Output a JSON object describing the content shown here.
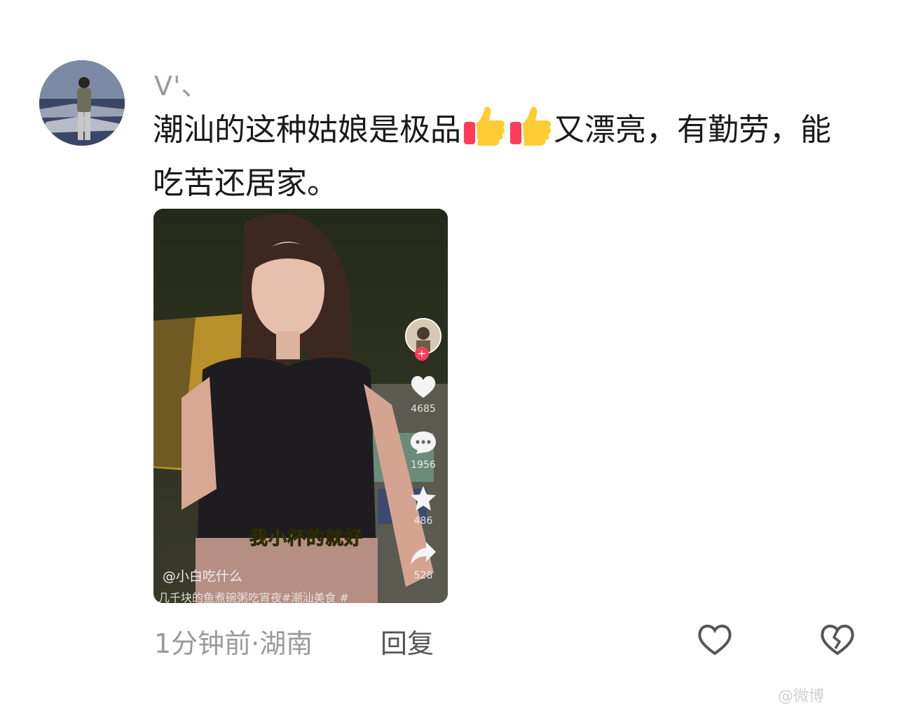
{
  "comment": {
    "username": "V'、",
    "text_part1": "潮汕的这种姑娘是极品",
    "emojis": [
      "thumbs-up-icon",
      "thumbs-up-icon"
    ],
    "text_part2": "又漂亮，有勤劳，能吃苦还居家。"
  },
  "video": {
    "caption": "我小杯的就好",
    "author": "@小白吃什么",
    "description": "几千块的鱼煮碗粥吃宵夜#潮汕美食 #",
    "likes": "4685",
    "comments": "1956",
    "favorites": "486",
    "shares": "528"
  },
  "footer": {
    "time_location": "1分钟前·湖南",
    "reply_label": "回复"
  },
  "watermark": "@微博"
}
